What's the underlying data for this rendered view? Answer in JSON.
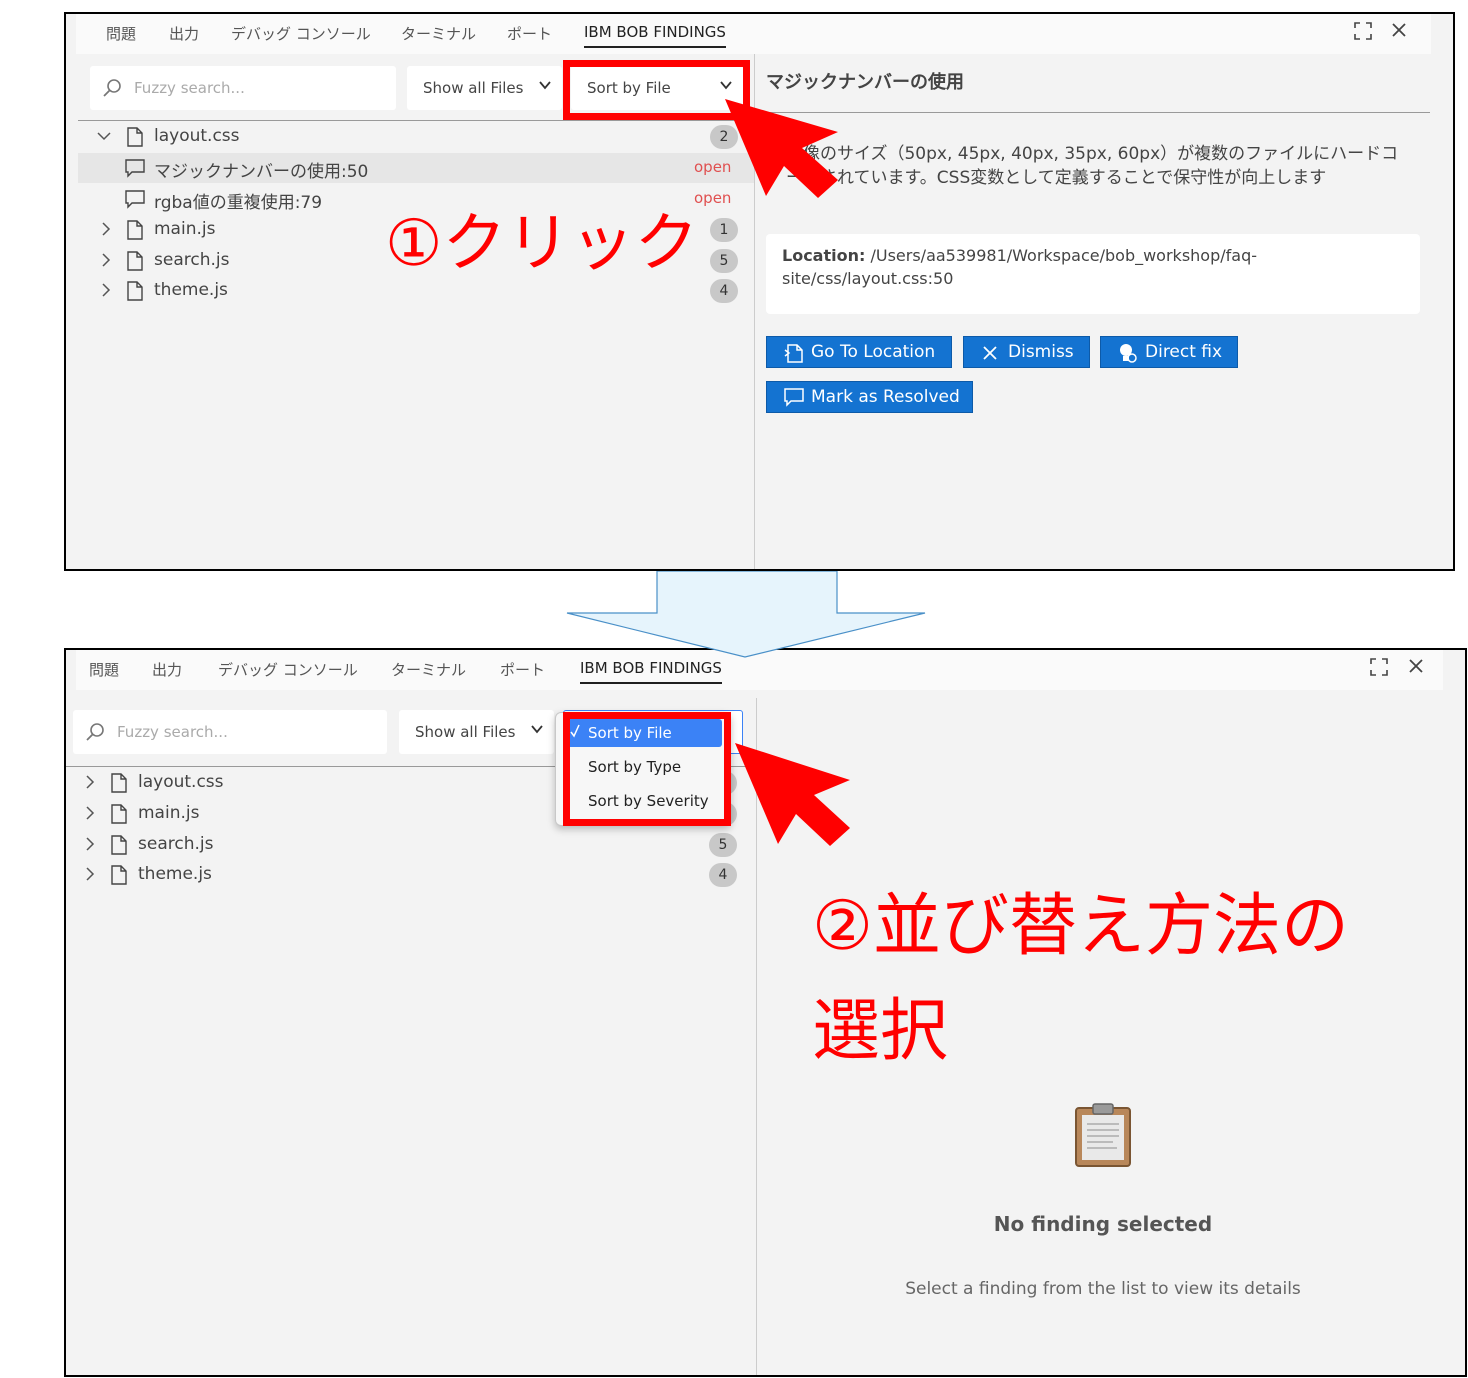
{
  "tabs": [
    "問題",
    "出力",
    "デバッグ コンソール",
    "ターミナル",
    "ポート",
    "IBM BOB FINDINGS"
  ],
  "search": {
    "placeholder": "Fuzzy search..."
  },
  "filter": {
    "selected": "Show all Files"
  },
  "sort": {
    "selected": "Sort by File",
    "options": [
      "Sort by File",
      "Sort by Type",
      "Sort by Severity"
    ]
  },
  "panel1": {
    "tree": [
      {
        "label": "layout.css",
        "count": "2"
      },
      {
        "label": "マジックナンバーの使用:50",
        "status": "open"
      },
      {
        "label": "rgba値の重複使用:79",
        "status": "open"
      },
      {
        "label": "main.js",
        "count": "1"
      },
      {
        "label": "search.js",
        "count": "5"
      },
      {
        "label": "theme.js",
        "count": "4"
      }
    ],
    "detail": {
      "title": "マジックナンバーの使用",
      "desc_line1": "画像のサイズ（50px, 45px, 40px, 35px, 60px）が複数のファイルにハードコ",
      "desc_line2": "ードされています。CSS変数として定義することで保守性が向上します",
      "location_label": "Location:",
      "location_line1": "/Users/aa539981/Workspace/bob_workshop/faq-",
      "location_line2": "site/css/layout.css:50",
      "buttons": [
        "Go To Location",
        "Dismiss",
        "Direct fix",
        "Mark as Resolved"
      ]
    }
  },
  "panel2": {
    "tree": [
      {
        "label": "layout.css",
        "count": "2"
      },
      {
        "label": "main.js",
        "count": "1"
      },
      {
        "label": "search.js",
        "count": "5"
      },
      {
        "label": "theme.js",
        "count": "4"
      }
    ],
    "empty": {
      "title": "No finding selected",
      "desc": "Select a finding from the list to view its details"
    }
  },
  "annotations": {
    "step1": "①クリック",
    "step2_line1": "②並び替え方法の",
    "step2_line2": "選択"
  },
  "colors": {
    "accent": "#1473d1",
    "highlight": "#ff0000",
    "status_open": "#e05050",
    "arrow_fill": "#e6f4fc"
  }
}
